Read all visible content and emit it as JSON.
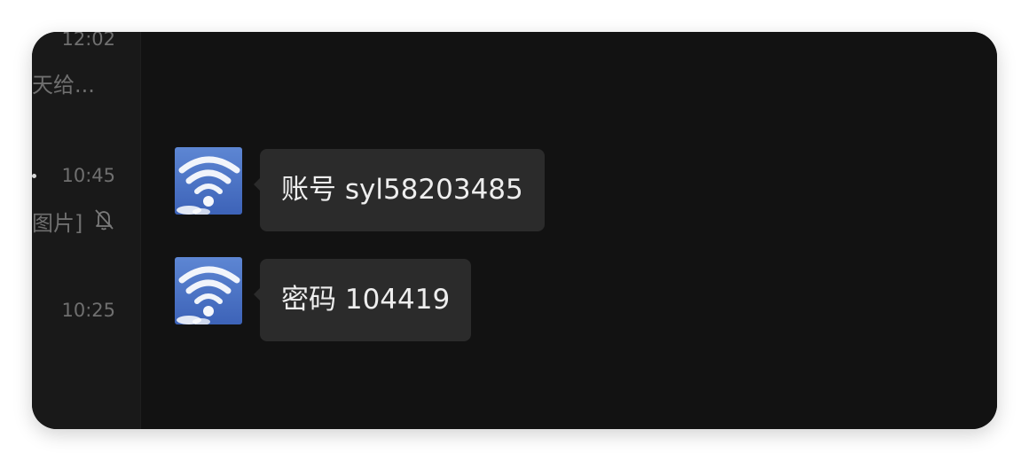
{
  "sidebar": {
    "items": [
      {
        "time": "12:02",
        "preview": "天给...",
        "muted": false
      },
      {
        "time": "10:45",
        "preview": "图片]",
        "muted": true,
        "unread_dot": true
      },
      {
        "time": "10:25",
        "preview": "",
        "muted": false
      }
    ]
  },
  "chat": {
    "messages": [
      {
        "avatar_icon": "wifi-cloud-icon",
        "text": "账号 syl58203485"
      },
      {
        "avatar_icon": "wifi-cloud-icon",
        "text": "密码 104419"
      }
    ]
  },
  "colors": {
    "window_bg": "#121212",
    "sidebar_bg": "#191919",
    "bubble_bg": "#2b2b2b",
    "bubble_text": "#eeeeee",
    "muted_text": "#6f6f6f",
    "avatar_bg": "#3d6cc1"
  },
  "icons": [
    "bell-slash-icon",
    "wifi-cloud-icon"
  ]
}
